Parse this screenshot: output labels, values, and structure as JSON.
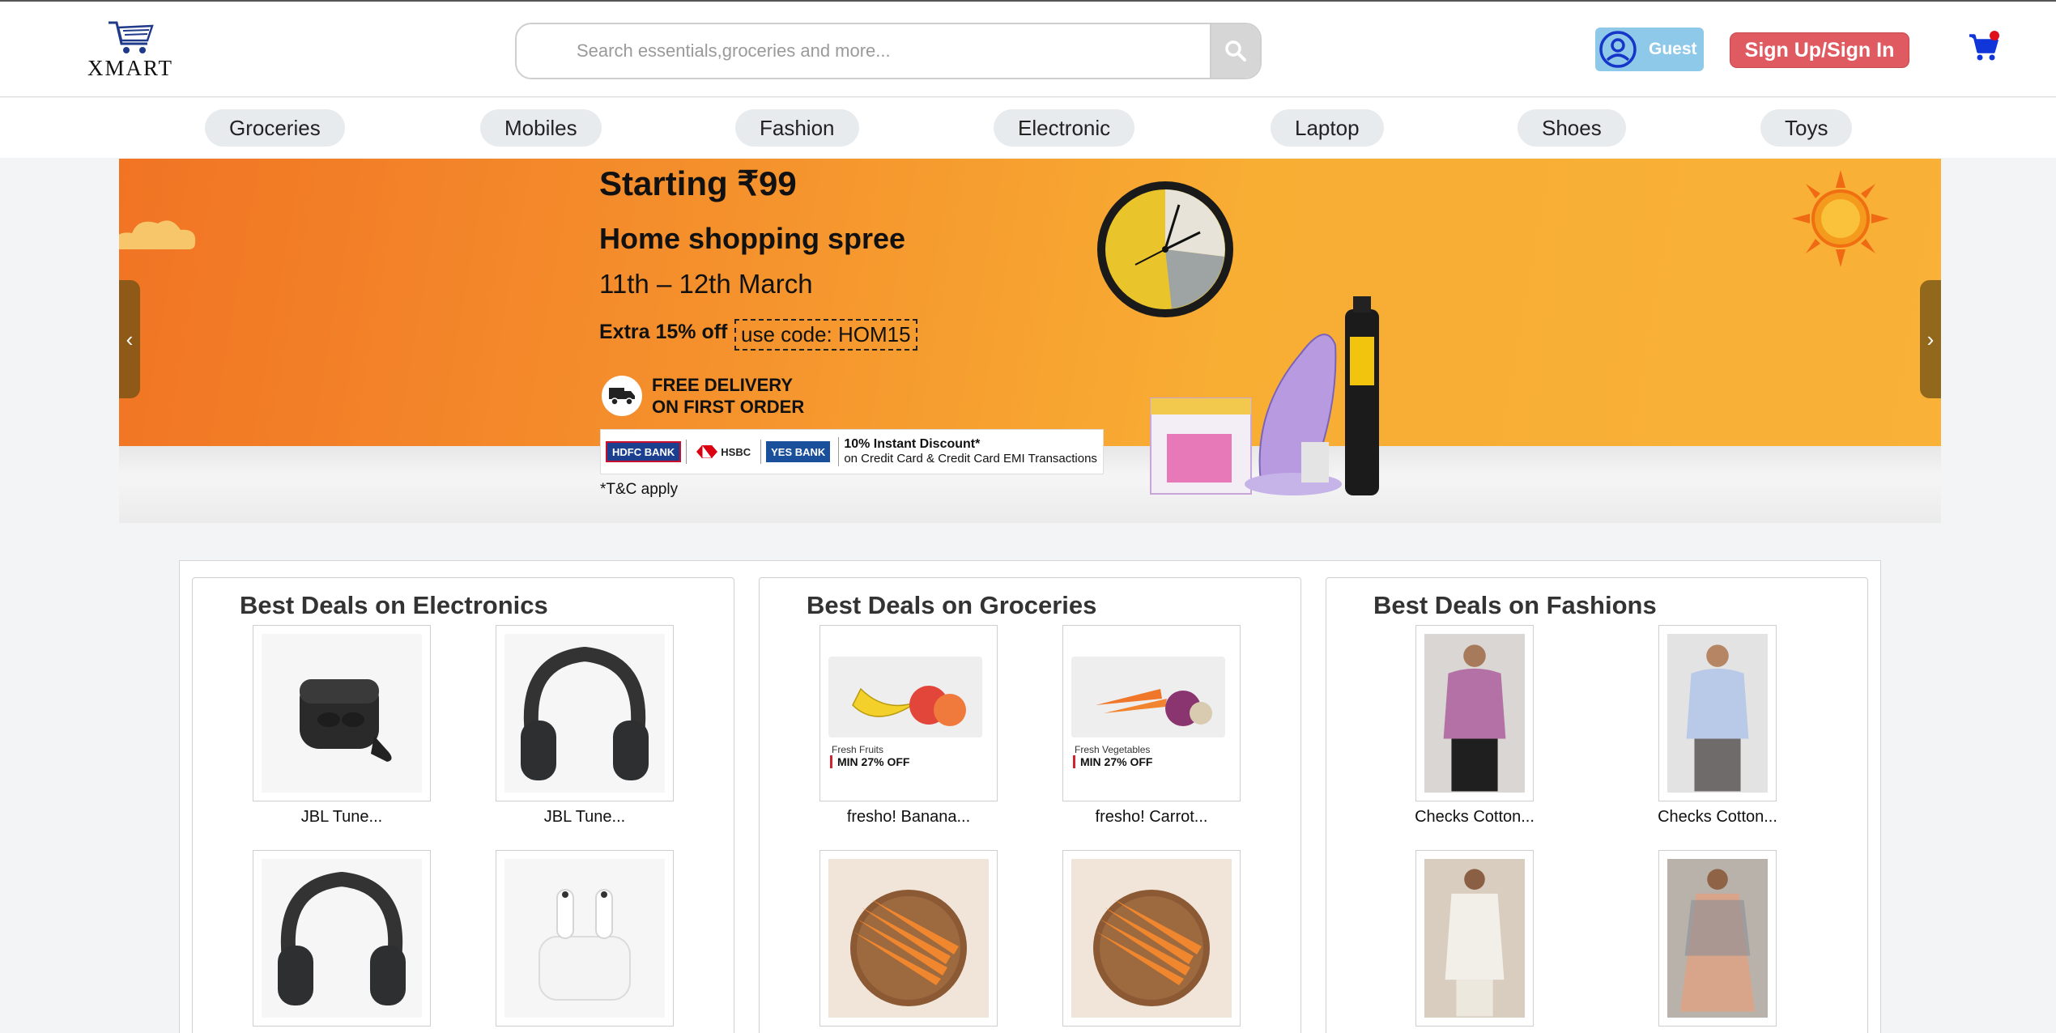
{
  "brand": {
    "logo_text": "XMART"
  },
  "search": {
    "placeholder": "Search essentials,groceries and more..."
  },
  "user": {
    "guest_label": "Guest",
    "signin_label": "Sign Up/Sign In"
  },
  "categories": [
    "Groceries",
    "Mobiles",
    "Fashion",
    "Electronic",
    "Laptop",
    "Shoes",
    "Toys"
  ],
  "banner": {
    "starting": "Starting ₹99",
    "headline": "Home shopping spree",
    "dates": "11th – 12th March",
    "extra": "Extra 15% off",
    "code": "use code: HOM15",
    "delivery_line1": "FREE DELIVERY",
    "delivery_line2": "ON FIRST ORDER",
    "banks": [
      "HDFC BANK",
      "HSBC",
      "YES BANK"
    ],
    "discount_line1": "10% Instant Discount*",
    "discount_line2": "on Credit Card & Credit Card EMI Transactions",
    "tc": "*T&C apply"
  },
  "deals": [
    {
      "title": "Best Deals on Electronics",
      "items": [
        {
          "name": "JBL Tune..."
        },
        {
          "name": "JBL Tune..."
        },
        {
          "name": ""
        },
        {
          "name": ""
        }
      ]
    },
    {
      "title": "Best Deals on Groceries",
      "items": [
        {
          "name": "fresho! Banana...",
          "sub": "Fresh Fruits",
          "offer": "MIN 27% OFF"
        },
        {
          "name": "fresho! Carrot...",
          "sub": "Fresh Vegetables",
          "offer": "MIN 27% OFF"
        },
        {
          "name": ""
        },
        {
          "name": ""
        }
      ]
    },
    {
      "title": "Best Deals on Fashions",
      "items": [
        {
          "name": "Checks Cotton..."
        },
        {
          "name": "Checks Cotton..."
        },
        {
          "name": ""
        },
        {
          "name": ""
        }
      ]
    }
  ],
  "colors": {
    "signin": "#e05a62",
    "guest": "#8fc9ea",
    "banner_orange": "#f5932d",
    "offer_red": "#d0242e"
  }
}
